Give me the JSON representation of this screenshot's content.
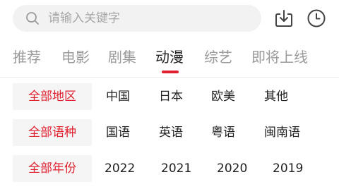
{
  "search": {
    "placeholder": "请输入关键字",
    "search_icon": "search-icon",
    "download_icon": "download-icon",
    "history_icon": "history-clock-icon"
  },
  "tabs": [
    {
      "label": "推荐",
      "active": false
    },
    {
      "label": "电影",
      "active": false
    },
    {
      "label": "剧集",
      "active": false
    },
    {
      "label": "动漫",
      "active": true
    },
    {
      "label": "综艺",
      "active": false
    },
    {
      "label": "即将上线",
      "active": false
    }
  ],
  "filters": [
    {
      "title": "全部地区",
      "options": [
        "中国",
        "日本",
        "欧美",
        "其他"
      ]
    },
    {
      "title": "全部语种",
      "options": [
        "国语",
        "英语",
        "粤语",
        "闽南语"
      ]
    },
    {
      "title": "全部年份",
      "options": [
        "2022",
        "2021",
        "2020",
        "2019"
      ]
    }
  ],
  "colors": {
    "accent": "#e0212f",
    "inactive_tab": "#9a9a9a",
    "active_tab": "#222222",
    "search_bg": "#f2f2f2",
    "filter_head_bg": "#f5f5f5"
  }
}
